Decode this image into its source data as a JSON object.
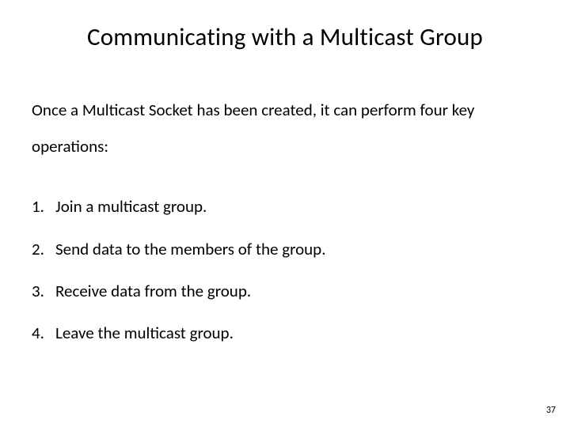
{
  "slide": {
    "title": "Communicating with a Multicast Group",
    "intro": "Once a Multicast Socket has been created, it can perform four key operations:",
    "operations": [
      "Join a multicast group.",
      "Send data to the members of the group.",
      "Receive data from the group.",
      "Leave the multicast group."
    ],
    "page_number": "37"
  }
}
